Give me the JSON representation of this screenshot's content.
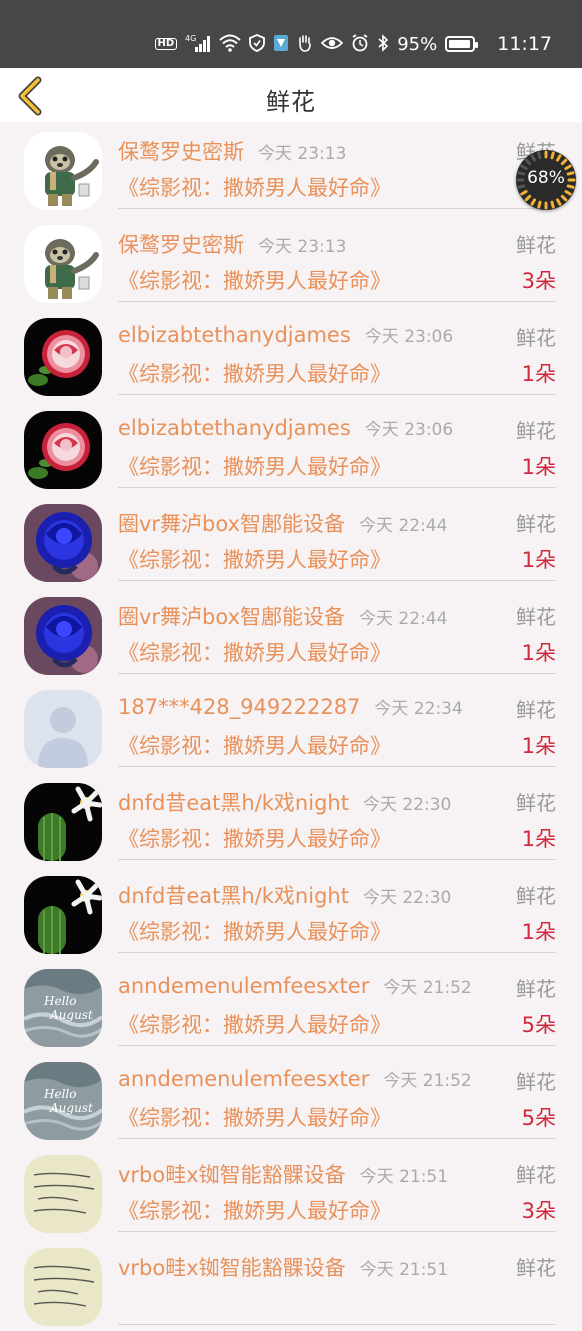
{
  "status_bar": {
    "hd": "HD",
    "network": "4G",
    "battery_percent": "95%",
    "battery_level": 0.95,
    "time": "11:17"
  },
  "header": {
    "title": "鲜花"
  },
  "float_badge": {
    "text": "68%",
    "level": 0.68
  },
  "colors": {
    "accent": "#e8915a",
    "count": "#d0283c",
    "muted": "#aaaaaa"
  },
  "items": [
    {
      "avatar": "sloth",
      "name": "保鹜罗史密斯",
      "time": "今天 23:13",
      "gift": "鲜花",
      "title": "《综影视：撒娇男人最好命》",
      "count": ""
    },
    {
      "avatar": "sloth",
      "name": "保鹜罗史密斯",
      "time": "今天 23:13",
      "gift": "鲜花",
      "title": "《综影视：撒娇男人最好命》",
      "count": "3朵"
    },
    {
      "avatar": "rose",
      "name": "elbizabtethanydjames",
      "time": "今天 23:06",
      "gift": "鲜花",
      "title": "《综影视：撒娇男人最好命》",
      "count": "1朵"
    },
    {
      "avatar": "rose",
      "name": "elbizabtethanydjames",
      "time": "今天 23:06",
      "gift": "鲜花",
      "title": "《综影视：撒娇男人最好命》",
      "count": "1朵"
    },
    {
      "avatar": "bluerose",
      "name": "圈vr舞泸box智鄌能设备",
      "time": "今天 22:44",
      "gift": "鲜花",
      "title": "《综影视：撒娇男人最好命》",
      "count": "1朵"
    },
    {
      "avatar": "bluerose",
      "name": "圈vr舞泸box智鄌能设备",
      "time": "今天 22:44",
      "gift": "鲜花",
      "title": "《综影视：撒娇男人最好命》",
      "count": "1朵"
    },
    {
      "avatar": "default",
      "name": "187***428_949222287",
      "time": "今天 22:34",
      "gift": "鲜花",
      "title": "《综影视：撒娇男人最好命》",
      "count": "1朵"
    },
    {
      "avatar": "cactus",
      "name": "dnfd昔eat黑h/k戏night",
      "time": "今天 22:30",
      "gift": "鲜花",
      "title": "《综影视：撒娇男人最好命》",
      "count": "1朵"
    },
    {
      "avatar": "cactus",
      "name": "dnfd昔eat黑h/k戏night",
      "time": "今天 22:30",
      "gift": "鲜花",
      "title": "《综影视：撒娇男人最好命》",
      "count": "1朵"
    },
    {
      "avatar": "ocean",
      "name": "anndemenulemfeesxter",
      "time": "今天 21:52",
      "gift": "鲜花",
      "title": "《综影视：撒娇男人最好命》",
      "count": "5朵"
    },
    {
      "avatar": "ocean",
      "name": "anndemenulemfeesxter",
      "time": "今天 21:52",
      "gift": "鲜花",
      "title": "《综影视：撒娇男人最好命》",
      "count": "5朵"
    },
    {
      "avatar": "note",
      "name": "vrbo畦x铷智能豁髁设备",
      "time": "今天 21:51",
      "gift": "鲜花",
      "title": "《综影视：撒娇男人最好命》",
      "count": "3朵"
    },
    {
      "avatar": "note",
      "name": "vrbo畦x铷智能豁髁设备",
      "time": "今天 21:51",
      "gift": "鲜花",
      "title": "",
      "count": ""
    }
  ]
}
